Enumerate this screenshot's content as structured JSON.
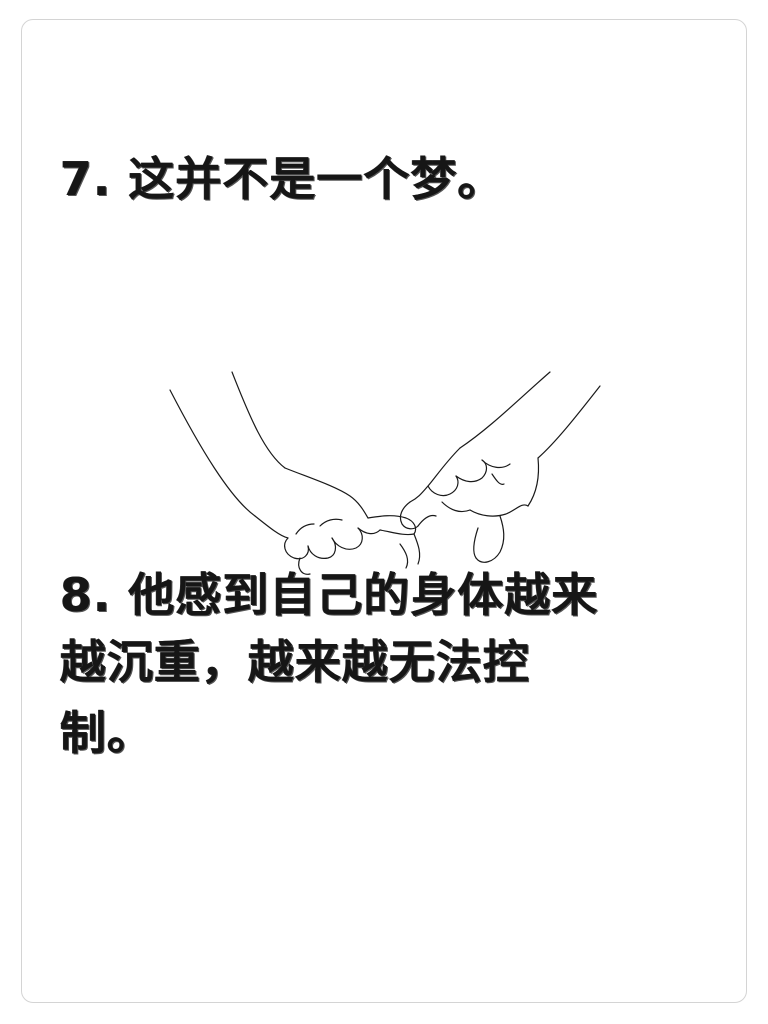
{
  "items": [
    {
      "text": "7. 这并不是一个梦。"
    },
    {
      "lines": [
        "8. 他感到自己的身体越来",
        "越沉重，越来越无法控",
        "制。"
      ]
    }
  ],
  "illustration": {
    "icon": "linked-pinky-hands-icon"
  },
  "colors": {
    "background": "#ffffff",
    "border": "#d4d4d4",
    "text": "#161616"
  }
}
